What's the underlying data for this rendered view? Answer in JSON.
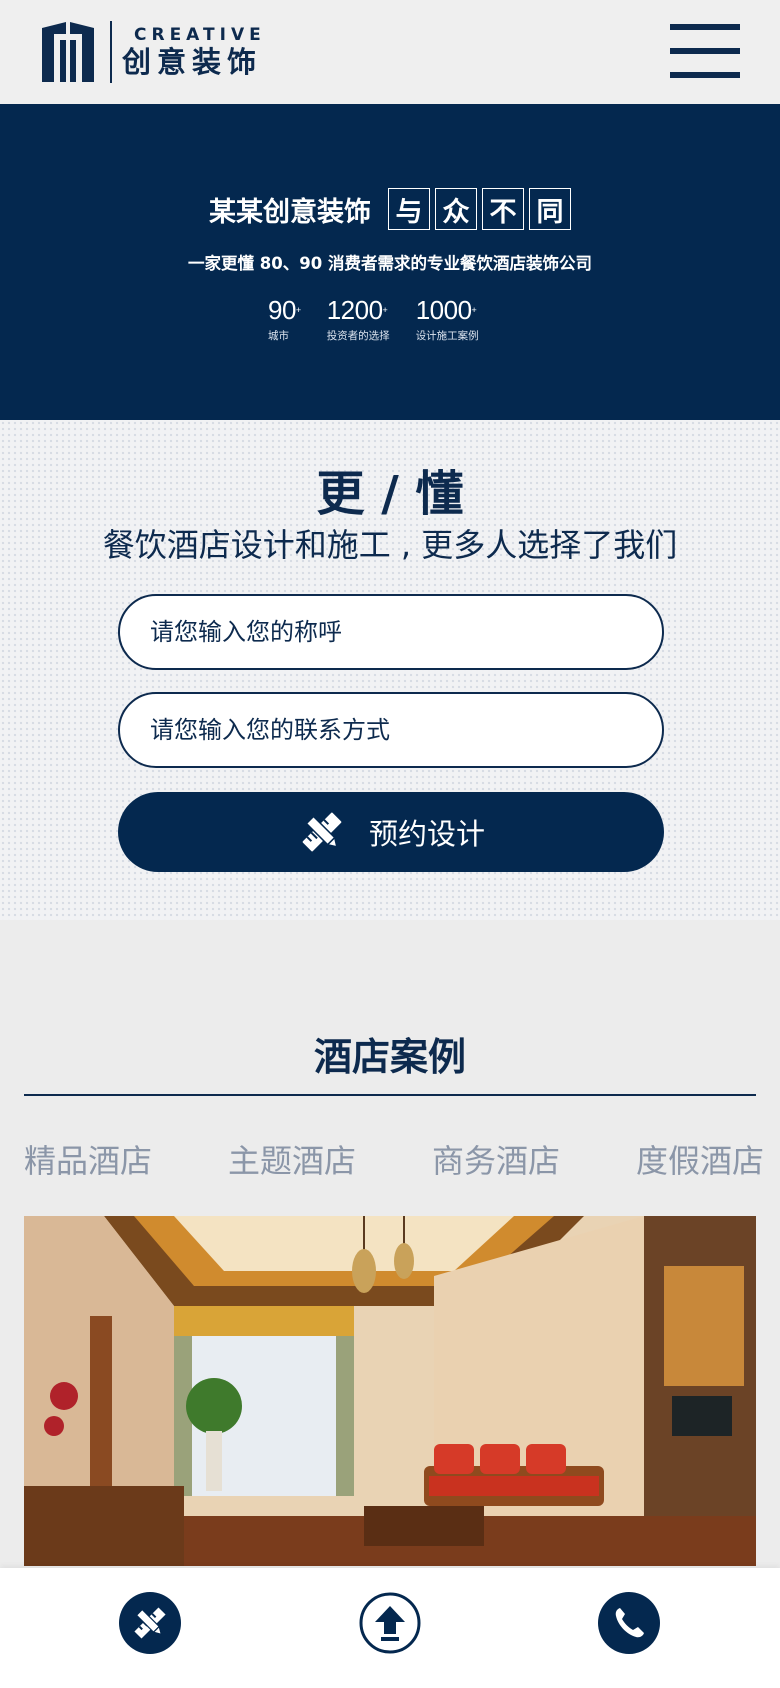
{
  "header": {
    "logo_en": "CREATIVE",
    "logo_cn": "创意装饰"
  },
  "banner": {
    "slogan_main": "某某创意装饰",
    "slogan_boxes": [
      "与",
      "众",
      "不",
      "同"
    ],
    "subtitle": "一家更懂 80、90  消费者需求的专业餐饮酒店装饰公司",
    "stats": [
      {
        "value": "90",
        "suffix": "+",
        "label": "城市"
      },
      {
        "value": "1200",
        "suffix": "+",
        "label": "投资者的选择"
      },
      {
        "value": "1000",
        "suffix": "+",
        "label": "设计施工案例"
      }
    ]
  },
  "form": {
    "title": "更 / 懂",
    "subtitle": "餐饮酒店设计和施工 , 更多人选择了我们",
    "name_placeholder": "请您输入您的称呼",
    "contact_placeholder": "请您输入您的联系方式",
    "submit_label": "预约设计"
  },
  "cases": {
    "title": "酒店案例",
    "tabs": [
      "精品酒店",
      "主题酒店",
      "商务酒店",
      "度假酒店"
    ]
  },
  "colors": {
    "brand_navy": "#04284f",
    "text_navy": "#0d2a4e",
    "tab_gray": "#8b96a8"
  },
  "icons": {
    "submit": "ruler-pencil-icon",
    "bottom_left": "ruler-pencil-icon",
    "bottom_center": "arrow-up-icon",
    "bottom_right": "phone-icon"
  }
}
